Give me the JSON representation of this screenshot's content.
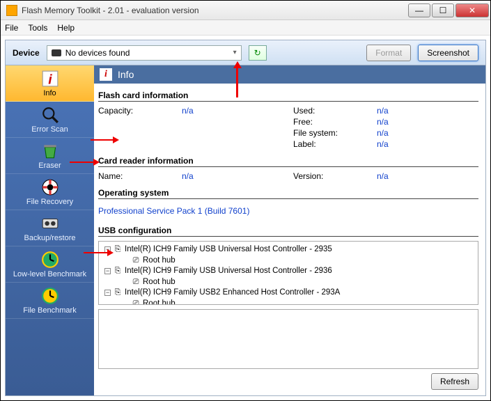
{
  "window": {
    "title": "Flash Memory Toolkit - 2.01 - evaluation version"
  },
  "menu": {
    "file": "File",
    "tools": "Tools",
    "help": "Help"
  },
  "devicebar": {
    "label": "Device",
    "selected": "No devices found",
    "format": "Format",
    "screenshot": "Screenshot"
  },
  "sidebar": {
    "info": "Info",
    "error_scan": "Error Scan",
    "eraser": "Eraser",
    "file_recovery": "File Recovery",
    "backup_restore": "Backup/restore",
    "low_level_benchmark": "Low-level Benchmark",
    "file_benchmark": "File Benchmark"
  },
  "panel": {
    "title": "Info",
    "flash_card_heading": "Flash card information",
    "capacity_k": "Capacity:",
    "capacity_v": "n/a",
    "used_k": "Used:",
    "used_v": "n/a",
    "free_k": "Free:",
    "free_v": "n/a",
    "fs_k": "File system:",
    "fs_v": "n/a",
    "label_k": "Label:",
    "label_v": "n/a",
    "reader_heading": "Card reader information",
    "name_k": "Name:",
    "name_v": "n/a",
    "version_k": "Version:",
    "version_v": "n/a",
    "os_heading": "Operating system",
    "os_value": "Professional Service Pack 1 (Build 7601)",
    "usb_heading": "USB configuration",
    "usb_tree": {
      "c1": "Intel(R) ICH9 Family USB Universal Host Controller - 2935",
      "c1_child": "Root hub",
      "c2": "Intel(R) ICH9 Family USB Universal Host Controller - 2936",
      "c2_child": "Root hub",
      "c3": "Intel(R) ICH9 Family USB2 Enhanced Host Controller - 293A",
      "c3_child": "Root hub"
    },
    "refresh": "Refresh"
  }
}
